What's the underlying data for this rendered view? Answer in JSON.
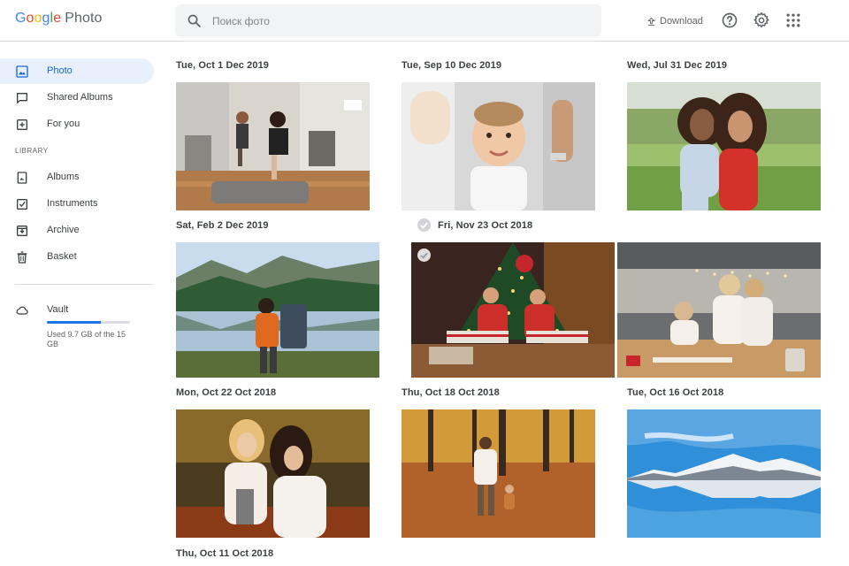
{
  "header": {
    "logo": {
      "letters": [
        "G",
        "o",
        "o",
        "g",
        "l",
        "e"
      ],
      "product": "Photo"
    },
    "search": {
      "placeholder": "Поиск фото",
      "value": ""
    },
    "download_label": "Download",
    "icons": [
      "help-icon",
      "gear-icon",
      "apps-grid-icon"
    ]
  },
  "sidebar": {
    "items": [
      {
        "label": "Photo",
        "icon": "photo-icon",
        "active": true
      },
      {
        "label": "Shared Albums",
        "icon": "chat-bubble-icon",
        "active": false
      },
      {
        "label": "For you",
        "icon": "plus-box-icon",
        "active": false
      }
    ],
    "library_heading": "LIBRARY",
    "library_items": [
      {
        "label": "Albums",
        "icon": "album-icon"
      },
      {
        "label": "Instruments",
        "icon": "checkbox-icon"
      },
      {
        "label": "Archive",
        "icon": "archive-icon"
      },
      {
        "label": "Basket",
        "icon": "trash-icon"
      }
    ],
    "vault": {
      "label": "Vault",
      "icon": "cloud-icon",
      "storage_text": "Used 9.7 GB of the 15 GB",
      "used_fraction": 0.65
    }
  },
  "groups": [
    {
      "date": "Tue, Oct 1 Dec 2019",
      "photo": "Family jumping in living room"
    },
    {
      "date": "Tue, Sep 10 Dec 2019",
      "photo": "Smiling baby held by hands"
    },
    {
      "date": "Wed, Jul 31 Dec 2019",
      "photo": "Mother hugging daughter outdoors"
    },
    {
      "date": "Sat, Feb 2 Dec 2019",
      "photo": "Hiker with backpack at mountain lake"
    },
    {
      "date": "Fri, Nov 23 Oct 2018",
      "photo": "Kids under Christmas tree",
      "selected": true
    },
    {
      "date": "",
      "photo": "Family baking in kitchen"
    },
    {
      "date": "Mon, Oct 22 Oct 2018",
      "photo": "Mother and daughter in autumn forest"
    },
    {
      "date": "Thu, Oct 18 Oct 2018",
      "photo": "Walking in autumn park"
    },
    {
      "date": "Tue, Oct 16 Oct 2018",
      "photo": "Snowy mountains reflected in lake"
    },
    {
      "date": "Thu, Oct 11 Oct 2018",
      "photo": ""
    }
  ],
  "colors": {
    "accent": "#1a73e8",
    "active_bg": "#e8f0fe",
    "text": "#3c4043"
  }
}
